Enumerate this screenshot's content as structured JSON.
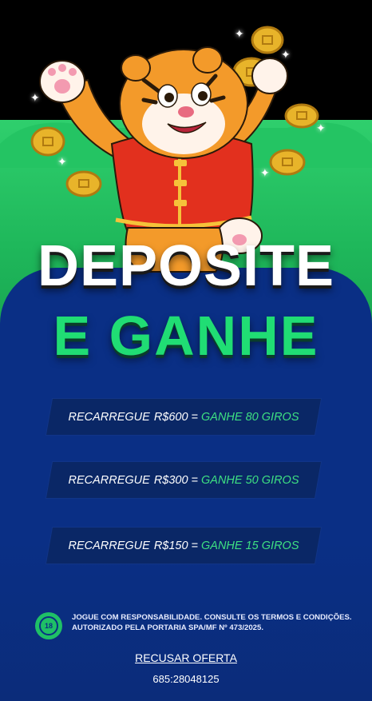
{
  "headline": {
    "line1": "DEPOSITE",
    "line2": "E GANHE"
  },
  "offers": [
    {
      "label": "RECARREGUE",
      "amount": "R$600",
      "eq": "=",
      "bonus": "GANHE 80 GIROS"
    },
    {
      "label": "RECARREGUE",
      "amount": "R$300",
      "eq": "=",
      "bonus": "GANHE 50 GIROS"
    },
    {
      "label": "RECARREGUE",
      "amount": "R$150",
      "eq": "=",
      "bonus": "GANHE 15 GIROS"
    }
  ],
  "age_badge": "18",
  "legal": {
    "line1": "JOGUE COM RESPONSABILIDADE. CONSULTE OS TERMOS E CONDIÇÕES.",
    "line2": "AUTORIZADO PELA PORTARIA SPA/MF Nº 473/2025."
  },
  "refuse_label": "RECUSAR OFERTA",
  "code": "685:28048125",
  "colors": {
    "accent_green": "#20dd74",
    "panel_blue": "#0a2f85",
    "offer_bg": "#0a2766"
  },
  "hero_image": "tiger-mascot-with-coins"
}
